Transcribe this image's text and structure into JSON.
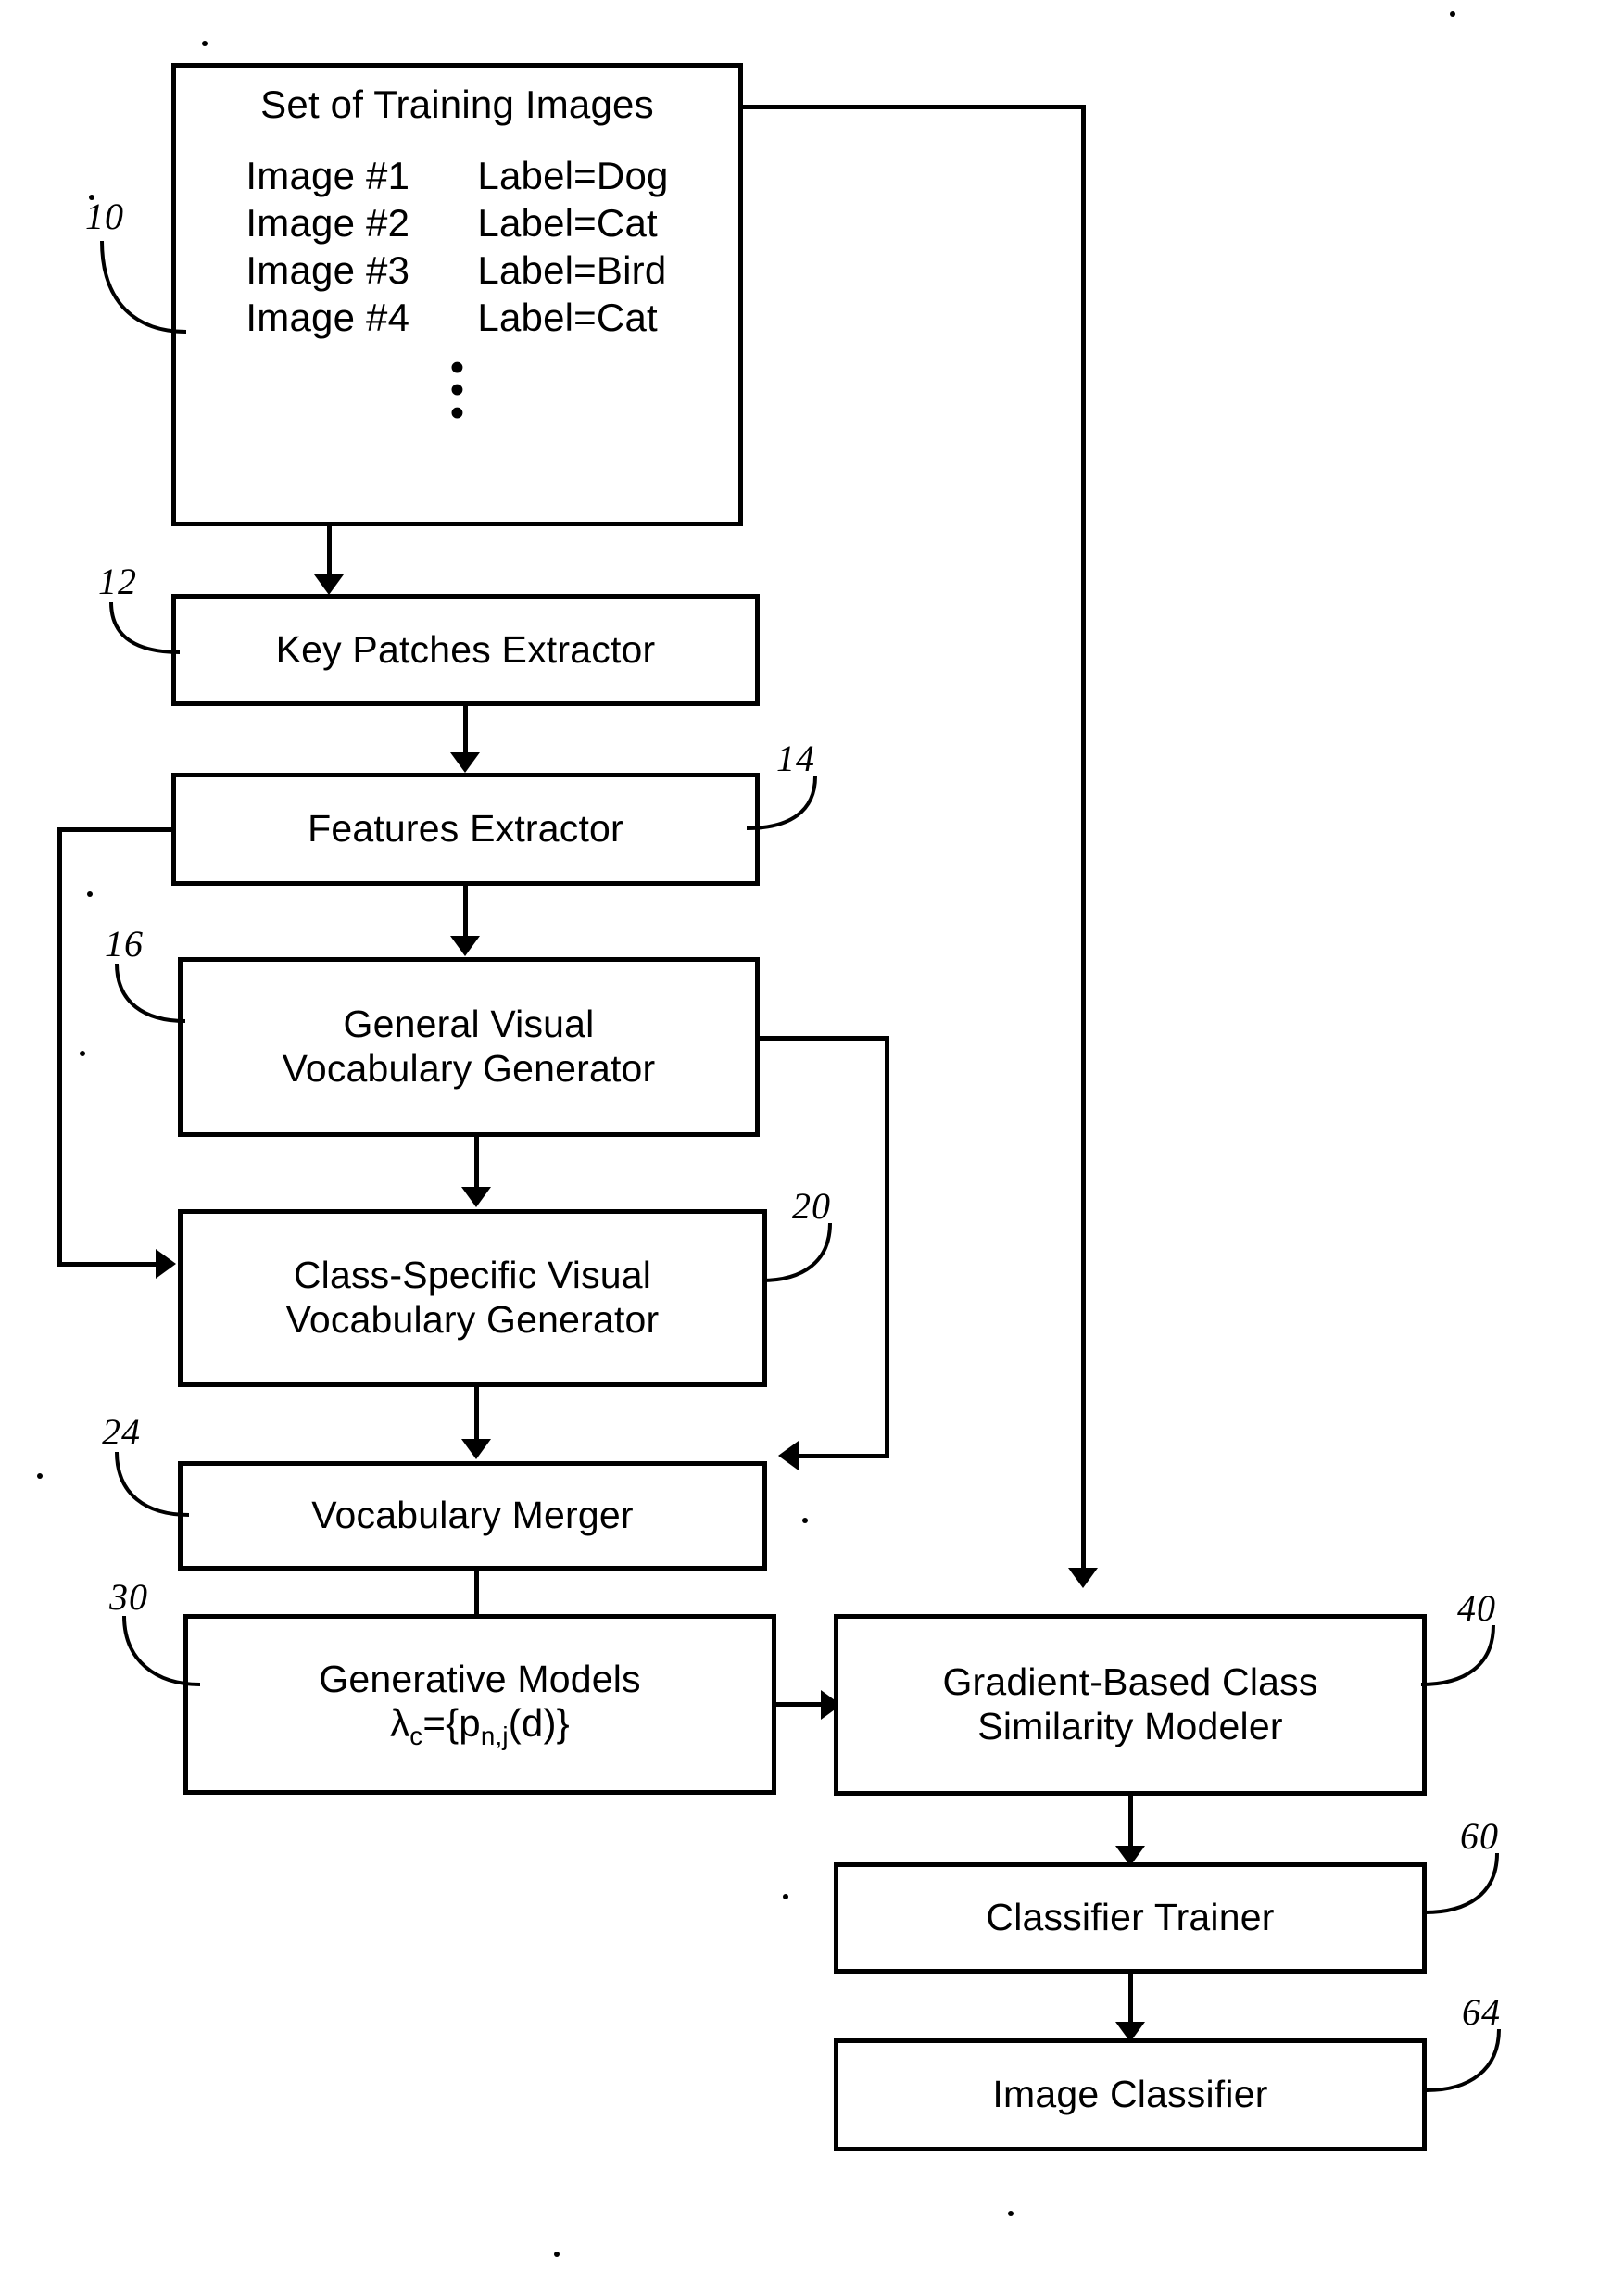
{
  "figure": {
    "type": "patent-flow-diagram",
    "blocks": [
      {
        "ref": "10",
        "name": "set-of-training-images",
        "title": "Set of Training Images",
        "rows": [
          {
            "image": "Image #1",
            "label": "Label=Dog"
          },
          {
            "image": "Image #2",
            "label": "Label=Cat"
          },
          {
            "image": "Image #3",
            "label": "Label=Bird"
          },
          {
            "image": "Image #4",
            "label": "Label=Cat"
          }
        ],
        "continuation": "vertical-ellipsis"
      },
      {
        "ref": "12",
        "name": "key-patches-extractor",
        "line1": "Key Patches Extractor",
        "line2": ""
      },
      {
        "ref": "14",
        "name": "features-extractor",
        "line1": "Features Extractor",
        "line2": ""
      },
      {
        "ref": "16",
        "name": "general-visual-vocabulary-generator",
        "line1": "General Visual",
        "line2": "Vocabulary Generator"
      },
      {
        "ref": "20",
        "name": "class-specific-visual-vocabulary-generator",
        "line1": "Class-Specific Visual",
        "line2": "Vocabulary Generator"
      },
      {
        "ref": "24",
        "name": "vocabulary-merger",
        "line1": "Vocabulary Merger",
        "line2": ""
      },
      {
        "ref": "30",
        "name": "generative-models",
        "line1": "Generative Models",
        "line2": "λ_c={p_n,j(d)}"
      },
      {
        "ref": "40",
        "name": "gradient-based-class-similarity-modeler",
        "line1": "Gradient-Based Class",
        "line2": "Similarity Modeler"
      },
      {
        "ref": "60",
        "name": "classifier-trainer",
        "line1": "Classifier Trainer",
        "line2": ""
      },
      {
        "ref": "64",
        "name": "image-classifier",
        "line1": "Image Classifier",
        "line2": ""
      }
    ],
    "formula": {
      "lambda": "λ",
      "lambda_sub": "c",
      "equals": "={p",
      "p_sub": "n,j",
      "tail": "(d)}"
    },
    "refs": {
      "r10": "10",
      "r12": "12",
      "r14": "14",
      "r16": "16",
      "r20": "20",
      "r24": "24",
      "r30": "30",
      "r40": "40",
      "r60": "60",
      "r64": "64"
    },
    "colors": {
      "ink": "#000000",
      "paper": "#ffffff"
    }
  }
}
